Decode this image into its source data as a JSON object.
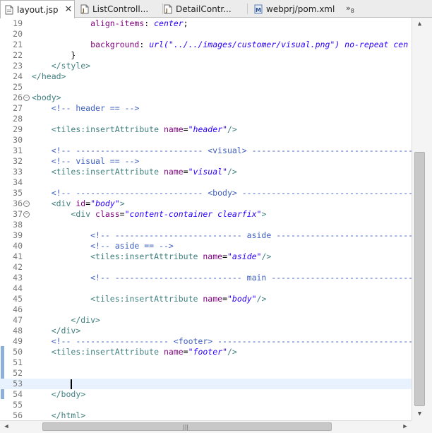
{
  "tabs": [
    {
      "label": "layout.jsp",
      "icon": "jsp-file-icon",
      "active": true,
      "close": "✕"
    },
    {
      "label": "ListControll...",
      "icon": "java-file-icon"
    },
    {
      "label": "DetailContr...",
      "icon": "java-file-icon"
    },
    {
      "label": "webprj/pom.xml",
      "icon": "maven-file-icon"
    }
  ],
  "tab_overflow": {
    "symbol": "»",
    "count": "8"
  },
  "editor": {
    "lines": [
      {
        "n": "19",
        "segs": [
          [
            "plain",
            "            "
          ],
          [
            "prop",
            "align-items"
          ],
          [
            "plain",
            ": "
          ],
          [
            "css",
            "center"
          ],
          [
            "plain",
            ";"
          ]
        ]
      },
      {
        "n": "20",
        "segs": []
      },
      {
        "n": "21",
        "segs": [
          [
            "plain",
            "            "
          ],
          [
            "prop",
            "background"
          ],
          [
            "plain",
            ": "
          ],
          [
            "css",
            "url(\"../../images/customer/visual.png\") no-repeat cen"
          ]
        ]
      },
      {
        "n": "22",
        "segs": [
          [
            "plain",
            "        }"
          ]
        ]
      },
      {
        "n": "23",
        "segs": [
          [
            "plain",
            "    "
          ],
          [
            "tag",
            "</style>"
          ]
        ]
      },
      {
        "n": "24",
        "segs": [
          [
            "tag",
            "</head>"
          ]
        ]
      },
      {
        "n": "25",
        "segs": []
      },
      {
        "n": "26",
        "fold": true,
        "segs": [
          [
            "tag",
            "<body>"
          ]
        ]
      },
      {
        "n": "27",
        "segs": [
          [
            "plain",
            "    "
          ],
          [
            "com",
            "<!-- header == -->"
          ]
        ]
      },
      {
        "n": "28",
        "segs": []
      },
      {
        "n": "29",
        "segs": [
          [
            "plain",
            "    "
          ],
          [
            "tag",
            "<tiles:insertAttribute"
          ],
          [
            "plain",
            " "
          ],
          [
            "attr",
            "name"
          ],
          [
            "plain",
            "="
          ],
          [
            "val",
            "\"header\""
          ],
          [
            "tag",
            "/>"
          ]
        ]
      },
      {
        "n": "30",
        "segs": []
      },
      {
        "n": "31",
        "segs": [
          [
            "plain",
            "    "
          ],
          [
            "com",
            "<!-- -------------------------- <visual> -------------------------------------"
          ]
        ]
      },
      {
        "n": "32",
        "segs": [
          [
            "plain",
            "    "
          ],
          [
            "com",
            "<!-- visual == -->"
          ]
        ]
      },
      {
        "n": "33",
        "segs": [
          [
            "plain",
            "    "
          ],
          [
            "tag",
            "<tiles:insertAttribute"
          ],
          [
            "plain",
            " "
          ],
          [
            "attr",
            "name"
          ],
          [
            "plain",
            "="
          ],
          [
            "val",
            "\"visual\""
          ],
          [
            "tag",
            "/>"
          ]
        ]
      },
      {
        "n": "34",
        "segs": []
      },
      {
        "n": "35",
        "segs": [
          [
            "plain",
            "    "
          ],
          [
            "com",
            "<!-- -------------------------- <body> ---------------------------------------"
          ]
        ]
      },
      {
        "n": "36",
        "fold": true,
        "segs": [
          [
            "plain",
            "    "
          ],
          [
            "tag",
            "<div"
          ],
          [
            "plain",
            " "
          ],
          [
            "attr",
            "id"
          ],
          [
            "plain",
            "="
          ],
          [
            "val",
            "\"body\""
          ],
          [
            "tag",
            ">"
          ]
        ]
      },
      {
        "n": "37",
        "fold": true,
        "segs": [
          [
            "plain",
            "        "
          ],
          [
            "tag",
            "<div"
          ],
          [
            "plain",
            " "
          ],
          [
            "attr",
            "class"
          ],
          [
            "plain",
            "="
          ],
          [
            "val",
            "\"content-container clearfix\""
          ],
          [
            "tag",
            ">"
          ]
        ]
      },
      {
        "n": "38",
        "segs": []
      },
      {
        "n": "39",
        "segs": [
          [
            "plain",
            "            "
          ],
          [
            "com",
            "<!-- -------------------------- aside ----------------------------"
          ]
        ]
      },
      {
        "n": "40",
        "segs": [
          [
            "plain",
            "            "
          ],
          [
            "com",
            "<!-- aside == -->"
          ]
        ]
      },
      {
        "n": "41",
        "segs": [
          [
            "plain",
            "            "
          ],
          [
            "tag",
            "<tiles:insertAttribute"
          ],
          [
            "plain",
            " "
          ],
          [
            "attr",
            "name"
          ],
          [
            "plain",
            "="
          ],
          [
            "val",
            "\"aside\""
          ],
          [
            "tag",
            "/>"
          ]
        ]
      },
      {
        "n": "42",
        "segs": []
      },
      {
        "n": "43",
        "segs": [
          [
            "plain",
            "            "
          ],
          [
            "com",
            "<!-- -------------------------- main -----------------------------"
          ]
        ]
      },
      {
        "n": "44",
        "segs": []
      },
      {
        "n": "45",
        "segs": [
          [
            "plain",
            "            "
          ],
          [
            "tag",
            "<tiles:insertAttribute"
          ],
          [
            "plain",
            " "
          ],
          [
            "attr",
            "name"
          ],
          [
            "plain",
            "="
          ],
          [
            "val",
            "\"body\""
          ],
          [
            "tag",
            "/>"
          ]
        ]
      },
      {
        "n": "46",
        "segs": []
      },
      {
        "n": "47",
        "segs": [
          [
            "plain",
            "        "
          ],
          [
            "tag",
            "</div>"
          ]
        ]
      },
      {
        "n": "48",
        "segs": [
          [
            "plain",
            "    "
          ],
          [
            "tag",
            "</div>"
          ]
        ]
      },
      {
        "n": "49",
        "segs": [
          [
            "plain",
            "    "
          ],
          [
            "com",
            "<!-- ------------------- <footer> -----------------------------------------"
          ]
        ]
      },
      {
        "n": "50",
        "segs": [
          [
            "plain",
            "    "
          ],
          [
            "tag",
            "<tiles:insertAttribute"
          ],
          [
            "plain",
            " "
          ],
          [
            "attr",
            "name"
          ],
          [
            "plain",
            "="
          ],
          [
            "val",
            "\"footer\""
          ],
          [
            "tag",
            "/>"
          ]
        ]
      },
      {
        "n": "51",
        "segs": []
      },
      {
        "n": "52",
        "segs": []
      },
      {
        "n": "53",
        "current": true,
        "segs": []
      },
      {
        "n": "54",
        "segs": [
          [
            "plain",
            "    "
          ],
          [
            "tag",
            "</body>"
          ]
        ]
      },
      {
        "n": "55",
        "segs": []
      },
      {
        "n": "56",
        "segs": [
          [
            "plain",
            "    "
          ],
          [
            "tag",
            "</html>"
          ]
        ]
      }
    ]
  },
  "scrollbar": {
    "up": "▲",
    "down": "▼",
    "left": "◀",
    "right": "▶",
    "grip": "|||"
  }
}
